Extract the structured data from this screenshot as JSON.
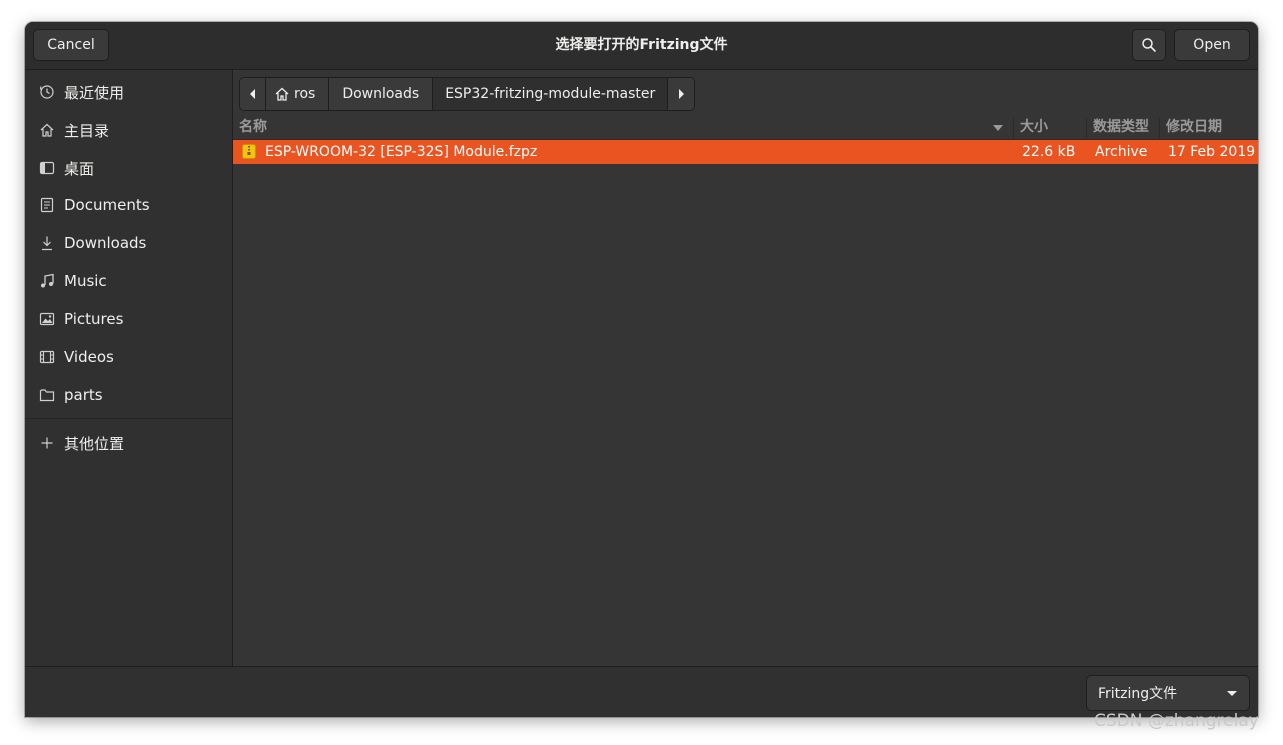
{
  "dialog": {
    "title": "选择要打开的Fritzing文件",
    "cancel_label": "Cancel",
    "open_label": "Open",
    "search_icon": "search-icon"
  },
  "sidebar": {
    "items": [
      {
        "label": "最近使用",
        "icon": "clock-icon"
      },
      {
        "label": "主目录",
        "icon": "home-icon"
      },
      {
        "label": "桌面",
        "icon": "desktop-icon"
      },
      {
        "label": "Documents",
        "icon": "document-icon"
      },
      {
        "label": "Downloads",
        "icon": "download-icon"
      },
      {
        "label": "Music",
        "icon": "music-icon"
      },
      {
        "label": "Pictures",
        "icon": "picture-icon"
      },
      {
        "label": "Videos",
        "icon": "video-icon"
      },
      {
        "label": "parts",
        "icon": "folder-icon"
      }
    ],
    "other_locations": "其他位置"
  },
  "pathbar": {
    "home_label": "ros",
    "segment_downloads": "Downloads",
    "segment_current": "ESP32-fritzing-module-master"
  },
  "columns": {
    "name": "名称",
    "size": "大小",
    "type": "数据类型",
    "modified": "修改日期"
  },
  "files": [
    {
      "name": "ESP-WROOM-32 [ESP-32S] Module.fzpz",
      "size": "22.6 kB",
      "type": "Archive",
      "modified": "17 Feb 2019",
      "selected": true
    }
  ],
  "filter": {
    "selected": "Fritzing文件"
  },
  "watermark": "CSDN @zhangrelay",
  "colors": {
    "accent": "#e95420",
    "background": "#353535",
    "headerbar": "#2d2d2d"
  }
}
